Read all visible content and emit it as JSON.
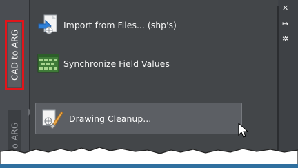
{
  "ribbon": {
    "active_tab": "CAD to ARG",
    "inactive_tab": "o ARG"
  },
  "panel": {
    "import_label": "Import from Files... (shp's)",
    "sync_label": "Synchronize Field Values",
    "cleanup_label": "Drawing Cleanup..."
  },
  "right_icons": {
    "close": "✕",
    "pin": "↦",
    "settings": "✲"
  },
  "colors": {
    "highlight_outline": "#e0151b",
    "panel_bg": "#434649",
    "button_bg": "#5c5f64"
  }
}
